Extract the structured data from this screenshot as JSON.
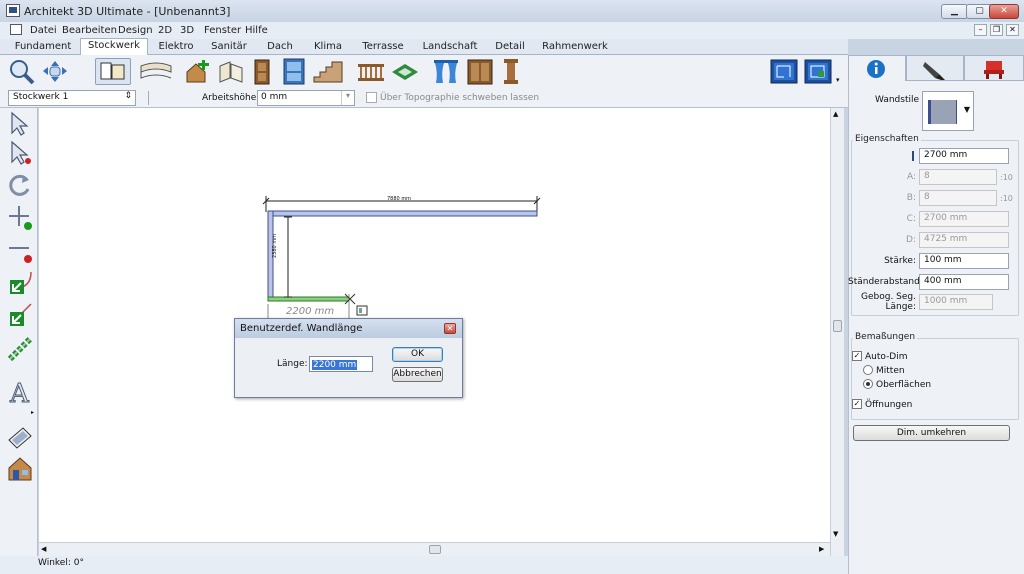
{
  "window": {
    "title": "Architekt 3D Ultimate - [Unbenannt3]"
  },
  "menu": [
    "Datei",
    "Bearbeiten",
    "Design",
    "2D",
    "3D",
    "Fenster",
    "Hilfe"
  ],
  "tabs": [
    "Fundament",
    "Stockwerk",
    "Elektro",
    "Sanitär",
    "Dach",
    "Klima",
    "Terrasse",
    "Landschaft",
    "Detail",
    "Rahmenwerk"
  ],
  "active_tab": "Stockwerk",
  "toolbar": {
    "icons": [
      "zoom-icon",
      "pan-icon",
      "floor-plan-icon",
      "wall-curve-icon",
      "add-room-icon",
      "wall-tool-icon",
      "door-icon",
      "window-icon",
      "stairs-icon",
      "railing-icon",
      "floor-pattern-icon",
      "curtain-icon",
      "cabinet-icon",
      "column-icon",
      "plan-view-icon",
      "plan-view-2-icon"
    ]
  },
  "propbar": {
    "floor": "Stockwerk 1",
    "wall_height_label": "Arbeitshöhe:",
    "wall_height_value": "0 mm",
    "topo_label": "Über Topographie schweben lassen"
  },
  "canvas": {
    "dim_top": "7880 mm",
    "dim_left": "2380 mm",
    "dim_live": "2200 mm"
  },
  "dialog": {
    "title": "Benutzerdef. Wandlänge",
    "length_label": "Länge:",
    "length_value": "2200 mm",
    "ok": "OK",
    "cancel": "Abbrechen"
  },
  "status": {
    "text": "Winkel: 0°"
  },
  "right_panel": {
    "wall_style_label": "Wandstile",
    "properties_label": "Eigenschaften",
    "height_value": "2700 mm",
    "a_label": "A:",
    "a_value": "8",
    "a_unit": ":10",
    "b_label": "B:",
    "b_value": "8",
    "b_unit": ":10",
    "c_label": "C:",
    "c_value": "2700 mm",
    "d_label": "D:",
    "d_value": "4725 mm",
    "thickness_label": "Stärke:",
    "thickness_value": "100 mm",
    "stud_label": "Ständerabstand:",
    "stud_value": "400 mm",
    "curved_label_1": "Gebog. Seg.",
    "curved_label_2": "Länge:",
    "curved_value": "1000 mm",
    "dimensions_label": "Bemaßungen",
    "autodim_label": "Auto-Dim",
    "center_label": "Mitten",
    "surfaces_label": "Oberflächen",
    "openings_label": "Öffnungen",
    "reverse_button": "Dim. umkehren"
  },
  "colors": {
    "accent": "#1a72c7",
    "wall": "#b9c4e8",
    "wall_stroke": "#3b4f8c",
    "green_wall": "#3aa53a"
  }
}
